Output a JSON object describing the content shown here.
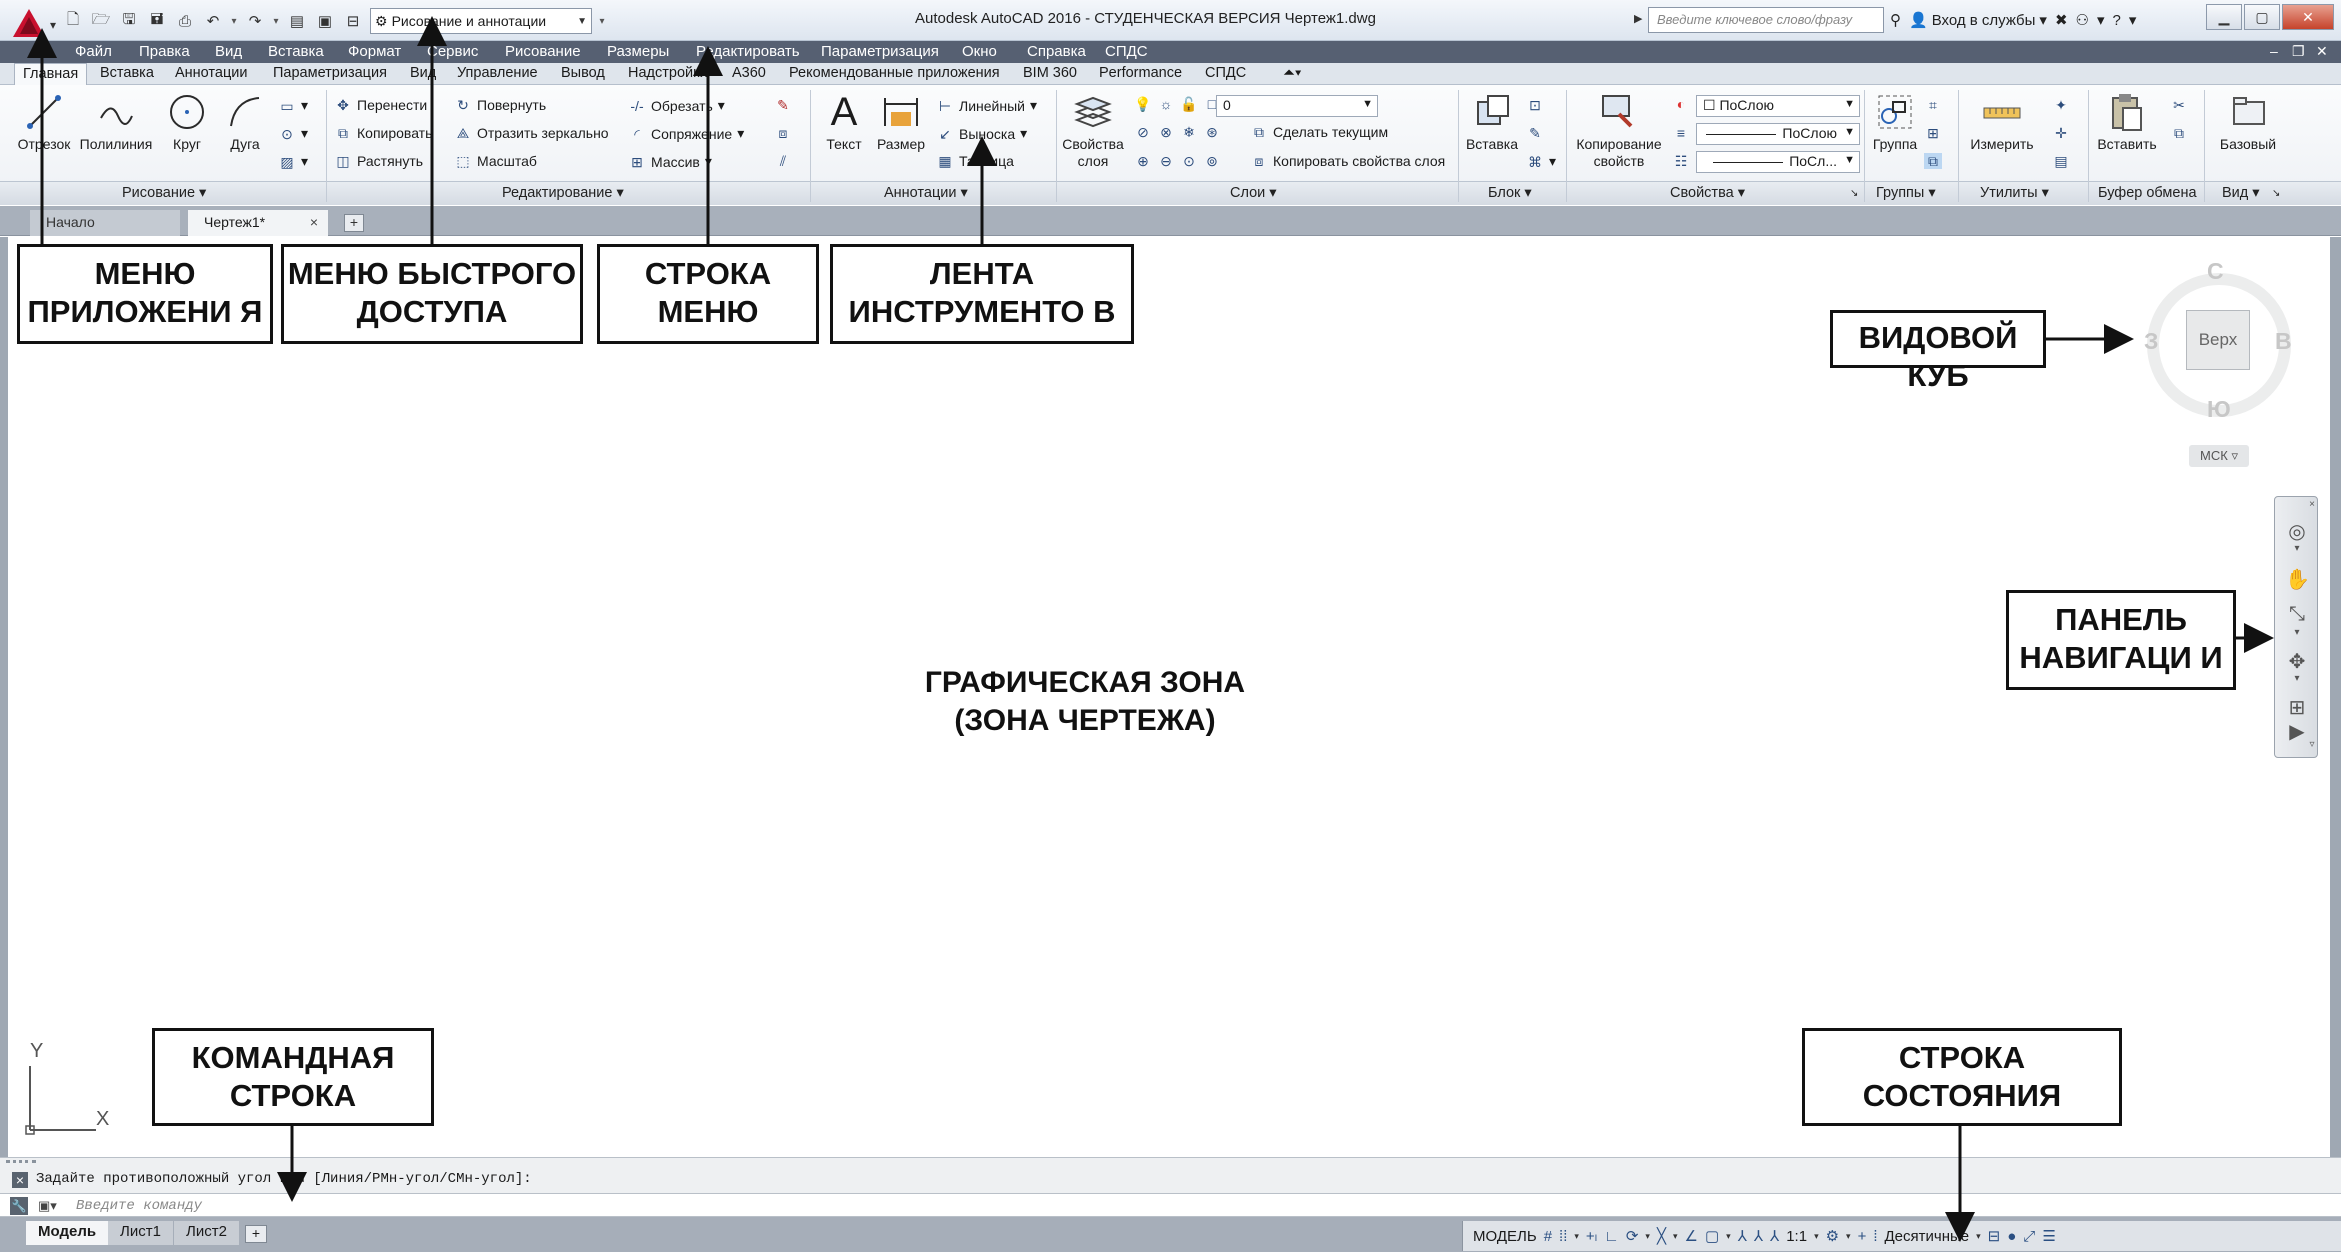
{
  "titlebar": {
    "workspace": "Рисование и аннотации",
    "title": "Autodesk AutoCAD 2016 - СТУДЕНЧЕСКАЯ ВЕРСИЯ    Чертеж1.dwg",
    "search_placeholder": "Введите ключевое слово/фразу",
    "signin": "Вход в службы",
    "help": "?"
  },
  "menubar": [
    "Файл",
    "Правка",
    "Вид",
    "Вставка",
    "Формат",
    "Сервис",
    "Рисование",
    "Размеры",
    "Редактировать",
    "Параметризация",
    "Окно",
    "Справка",
    "СПДС"
  ],
  "ribbon_tabs": [
    "Главная",
    "Вставка",
    "Аннотации",
    "Параметризация",
    "Вид",
    "Управление",
    "Вывод",
    "Надстройки",
    "A360",
    "Рекомендованные приложения",
    "BIM 360",
    "Performance",
    "СПДС"
  ],
  "draw_panel": {
    "line": "Отрезок",
    "polyline": "Полилиния",
    "circle": "Круг",
    "arc": "Дуга",
    "title": "Рисование"
  },
  "modify_panel": {
    "move": "Перенести",
    "rotate": "Повернуть",
    "trim": "Обрезать",
    "copy": "Копировать",
    "mirror": "Отразить зеркально",
    "fillet": "Сопряжение",
    "stretch": "Растянуть",
    "scale": "Масштаб",
    "array": "Массив",
    "title": "Редактирование"
  },
  "annot_panel": {
    "text": "Текст",
    "dim": "Размер",
    "linear": "Линейный",
    "leader": "Выноска",
    "table": "Таблица",
    "title": "Аннотации"
  },
  "layers_panel": {
    "props": "Свойства слоя",
    "layer_value": "0",
    "make_current": "Сделать текущим",
    "match_layer": "Копировать свойства слоя",
    "title": "Слои"
  },
  "block_panel": {
    "insert": "Вставка",
    "title": "Блок"
  },
  "props_panel": {
    "match": "Копирование свойств",
    "color": "ПоСлою",
    "linetype": "ПоСлою",
    "lineweight": "ПоСл...",
    "title": "Свойства"
  },
  "groups_panel": {
    "group": "Группа",
    "title": "Группы"
  },
  "utils_panel": {
    "measure": "Измерить",
    "title": "Утилиты"
  },
  "clip_panel": {
    "paste": "Вставить",
    "title": "Буфер обмена"
  },
  "view_panel": {
    "base": "Базовый",
    "title": "Вид"
  },
  "file_tabs": {
    "start": "Начало",
    "doc": "Чертеж1*"
  },
  "drawing": {
    "center_label": "ГРАФИЧЕСКАЯ ЗОНА (ЗОНА ЧЕРТЕЖА)",
    "ucs_x": "X",
    "ucs_y": "Y"
  },
  "callouts": {
    "app_menu": "МЕНЮ ПРИЛОЖЕНИ Я",
    "qat": "МЕНЮ БЫСТРОГО ДОСТУПА",
    "menubar": "СТРОКА МЕНЮ",
    "ribbon": "ЛЕНТА ИНСТРУМЕНТО В",
    "viewcube": "ВИДОВОЙ КУБ",
    "navbar": "ПАНЕЛЬ НАВИГАЦИ И",
    "cmdline": "КОМАНДНАЯ СТРОКА",
    "statusbar": "СТРОКА СОСТОЯНИЯ"
  },
  "viewcube": {
    "north": "С",
    "south": "Ю",
    "west": "З",
    "east": "В",
    "face": "Верх",
    "ucs": "МСК"
  },
  "command": {
    "history": "Задайте противоположный угол или [Линия/РМн-угол/СМн-угол]:",
    "placeholder": "Введите команду"
  },
  "layout_tabs": [
    "Модель",
    "Лист1",
    "Лист2"
  ],
  "status": {
    "model": "МОДЕЛЬ",
    "scale": "1:1",
    "units": "Десятичные"
  }
}
